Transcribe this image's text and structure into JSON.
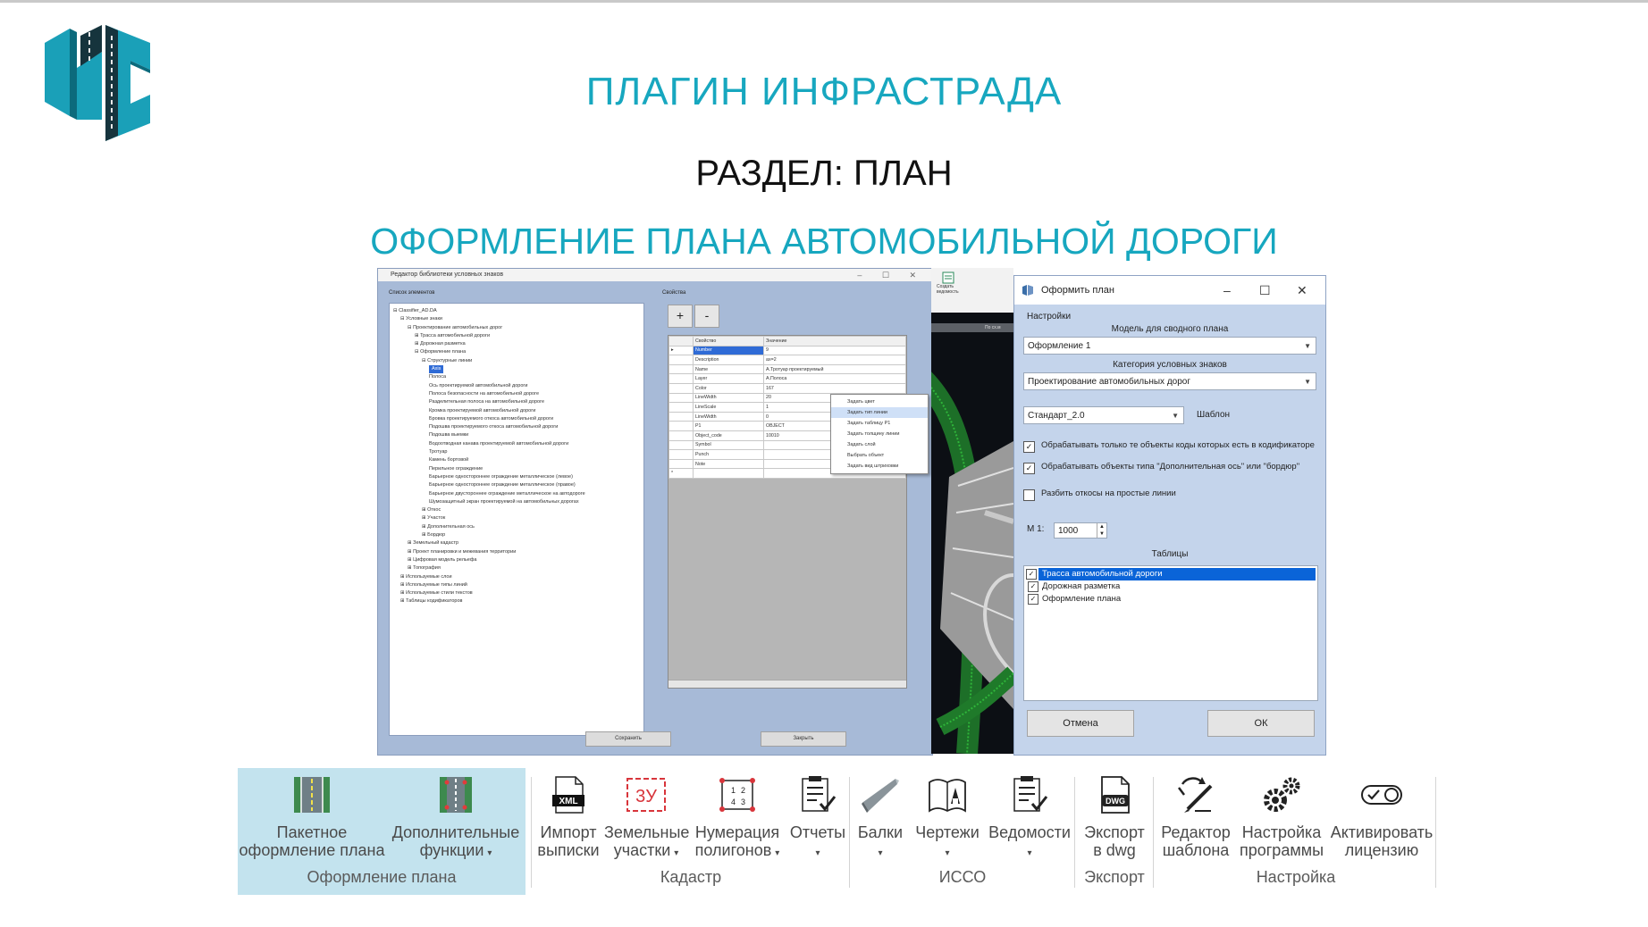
{
  "slide": {
    "title": "ПЛАГИН ИНФРАСТРАДА",
    "section": "РАЗДЕЛ: ПЛАН",
    "subtitle": "ОФОРМЛЕНИЕ ПЛАНА АВТОМОБИЛЬНОЙ ДОРОГИ",
    "accent_color": "#17a7bf"
  },
  "library_editor": {
    "title": "Редактор библиотеки условных знаков",
    "window_buttons": "– ☐ ✕",
    "elements_group": "Список элементов",
    "properties_group": "Свойства",
    "tree": [
      {
        "level": 0,
        "text": "⊟  Classifier_AD.DA"
      },
      {
        "level": 1,
        "text": "⊟  Условные знаки"
      },
      {
        "level": 2,
        "text": "⊟  Проектирование автомобильных дорог"
      },
      {
        "level": 3,
        "text": "⊞  Трасса автомобильной дороги"
      },
      {
        "level": 3,
        "text": "⊞  Дорожная разметка"
      },
      {
        "level": 3,
        "text": "⊟  Оформление плана"
      },
      {
        "level": 4,
        "text": "⊟  Структурные линии"
      },
      {
        "level": 5,
        "text": "Axis",
        "selected": true
      },
      {
        "level": 5,
        "text": "Полоса"
      },
      {
        "level": 5,
        "text": "Ось проектируемой автомобильной дороги"
      },
      {
        "level": 5,
        "text": "Полоса безопасности на автомобильной дороге"
      },
      {
        "level": 5,
        "text": "Разделительная полоса на автомобильной дороге"
      },
      {
        "level": 5,
        "text": "Кромка проектируемой автомобильной дороги"
      },
      {
        "level": 5,
        "text": "Бровка проектируемого откоса автомобильной дороги"
      },
      {
        "level": 5,
        "text": "Подошва проектируемого откоса автомобильной дороги"
      },
      {
        "level": 5,
        "text": "Подошва выемки"
      },
      {
        "level": 5,
        "text": "Водоотводная канава проектируемой автомобильной дороги"
      },
      {
        "level": 5,
        "text": "Тротуар"
      },
      {
        "level": 5,
        "text": "Камень бортовой"
      },
      {
        "level": 5,
        "text": "Перильное ограждение"
      },
      {
        "level": 5,
        "text": "Барьерное одностороннее ограждение металлическое (левое)"
      },
      {
        "level": 5,
        "text": "Барьерное одностороннее ограждение металлическое (правое)"
      },
      {
        "level": 5,
        "text": "Барьерное двустороннее ограждение металлическое на автодороге"
      },
      {
        "level": 5,
        "text": "Шумозащитный экран проектируемой на автомобильных дорогах"
      },
      {
        "level": 4,
        "text": "⊞  Откос"
      },
      {
        "level": 4,
        "text": "⊞  Участок"
      },
      {
        "level": 4,
        "text": "⊞  Дополнительная ось"
      },
      {
        "level": 4,
        "text": "⊞  Бордюр"
      },
      {
        "level": 2,
        "text": "⊞  Земельный кадастр"
      },
      {
        "level": 2,
        "text": "⊞  Проект планировки и межевания территории"
      },
      {
        "level": 2,
        "text": "⊞  Цифровая модель рельефа"
      },
      {
        "level": 2,
        "text": "⊞  Топография"
      },
      {
        "level": 1,
        "text": "⊞  Используемые слои"
      },
      {
        "level": 1,
        "text": "⊞  Используемые типы линий"
      },
      {
        "level": 1,
        "text": "⊞  Используемые стили текстов"
      },
      {
        "level": 1,
        "text": "⊞  Таблицы кодификаторов"
      }
    ],
    "plus_label": "+",
    "minus_label": "-",
    "grid_header": {
      "key": "Свойство",
      "value": "Значение"
    },
    "properties": [
      {
        "key": "Number",
        "value": "9",
        "selected": true
      },
      {
        "key": "Description",
        "value": "ax=2"
      },
      {
        "key": "Name",
        "value": "А.Тротуар проектируемый"
      },
      {
        "key": "Layer",
        "value": "А.Полоса"
      },
      {
        "key": "Color",
        "value": "167"
      },
      {
        "key": "LineWidth",
        "value": "20"
      },
      {
        "key": "LineScale",
        "value": "1"
      },
      {
        "key": "LineWidth",
        "value": "0"
      },
      {
        "key": "P1",
        "value": "OBJECT"
      },
      {
        "key": "Object_code",
        "value": "10010"
      },
      {
        "key": "Symbol",
        "value": ""
      },
      {
        "key": "Punch",
        "value": ""
      },
      {
        "key": "Note",
        "value": ""
      }
    ],
    "context_menu": [
      "Задать цвет",
      "Задать тип линии",
      "Задать таблицу Р1",
      "Задать толщину линии",
      "Задать слой",
      "Выбрать объект",
      "Задать вид штриховки"
    ],
    "context_highlight_index": 1,
    "save_label": "Сохранить",
    "close_label": "Закрыть"
  },
  "cad": {
    "ribbon_label": "Создать ведомость",
    "tab_label": "По сх.м"
  },
  "plan_dialog": {
    "title": "Оформить план",
    "window_buttons": {
      "min": "–",
      "max": "☐",
      "close": "✕"
    },
    "settings_label": "Настройки",
    "model_label": "Модель для сводного плана",
    "model_value": "Оформление 1",
    "category_label": "Категория условных знаков",
    "category_value": "Проектирование автомобильных дорог",
    "template_value": "Стандарт_2.0",
    "template_label": "Шаблон",
    "options": [
      {
        "checked": true,
        "text": "Обрабатывать только те объекты коды которых есть в кодификаторе"
      },
      {
        "checked": true,
        "text": "Обрабатывать объекты типа \"Дополнительная ось\" или \"бордюр\""
      },
      {
        "checked": false,
        "text": "Разбить откосы на простые линии"
      }
    ],
    "scale_label": "М 1:",
    "scale_value": "1000",
    "tables_label": "Таблицы",
    "tables": [
      {
        "checked": true,
        "text": "Трасса автомобильной дороги",
        "selected": true
      },
      {
        "checked": true,
        "text": "Дорожная разметка"
      },
      {
        "checked": true,
        "text": "Оформление плана"
      }
    ],
    "cancel_label": "Отмена",
    "ok_label": "ОК"
  },
  "ribbon": {
    "items": [
      {
        "name": "batch-plan",
        "label1": "Пакетное",
        "label2": "оформление плана",
        "icon": "road-batch-icon",
        "dropdown": false
      },
      {
        "name": "extra-functions",
        "label1": "Дополнительные",
        "label2": "функции",
        "icon": "road-functions-icon",
        "dropdown": true
      },
      {
        "name": "import-extract",
        "label1": "Импорт",
        "label2": "выписки",
        "icon": "xml-file-icon",
        "dropdown": false
      },
      {
        "name": "land-plots",
        "label1": "Земельные",
        "label2": "участки",
        "icon": "land-plot-icon",
        "dropdown": true
      },
      {
        "name": "polygon-numbering",
        "label1": "Нумерация",
        "label2": "полигонов",
        "icon": "polygon-numbering-icon",
        "dropdown": true
      },
      {
        "name": "reports",
        "label1": "Отчеты",
        "label2": "",
        "icon": "report-icon",
        "dropdown": true
      },
      {
        "name": "beams",
        "label1": "Балки",
        "label2": "",
        "icon": "beam-icon",
        "dropdown": true
      },
      {
        "name": "drawings",
        "label1": "Чертежи",
        "label2": "",
        "icon": "drawing-icon",
        "dropdown": true
      },
      {
        "name": "statements",
        "label1": "Ведомости",
        "label2": "",
        "icon": "statement-icon",
        "dropdown": true
      },
      {
        "name": "export-dwg",
        "label1": "Экспорт",
        "label2": "в dwg",
        "icon": "dwg-file-icon",
        "dropdown": false
      },
      {
        "name": "template-editor",
        "label1": "Редактор",
        "label2": "шаблона",
        "icon": "template-editor-icon",
        "dropdown": false
      },
      {
        "name": "program-settings",
        "label1": "Настройка",
        "label2": "программы",
        "icon": "gears-icon",
        "dropdown": false
      },
      {
        "name": "activate-license",
        "label1": "Активировать",
        "label2": "лицензию",
        "icon": "toggle-icon",
        "dropdown": false
      }
    ],
    "groups": [
      {
        "name": "plan-design",
        "label": "Оформление плана"
      },
      {
        "name": "cadastre",
        "label": "Кадастр"
      },
      {
        "name": "isso",
        "label": "ИССО"
      },
      {
        "name": "export",
        "label": "Экспорт"
      },
      {
        "name": "settings",
        "label": "Настройка"
      }
    ],
    "dropdown_glyph": "▾",
    "highlight_color": "#c3e3ee"
  }
}
